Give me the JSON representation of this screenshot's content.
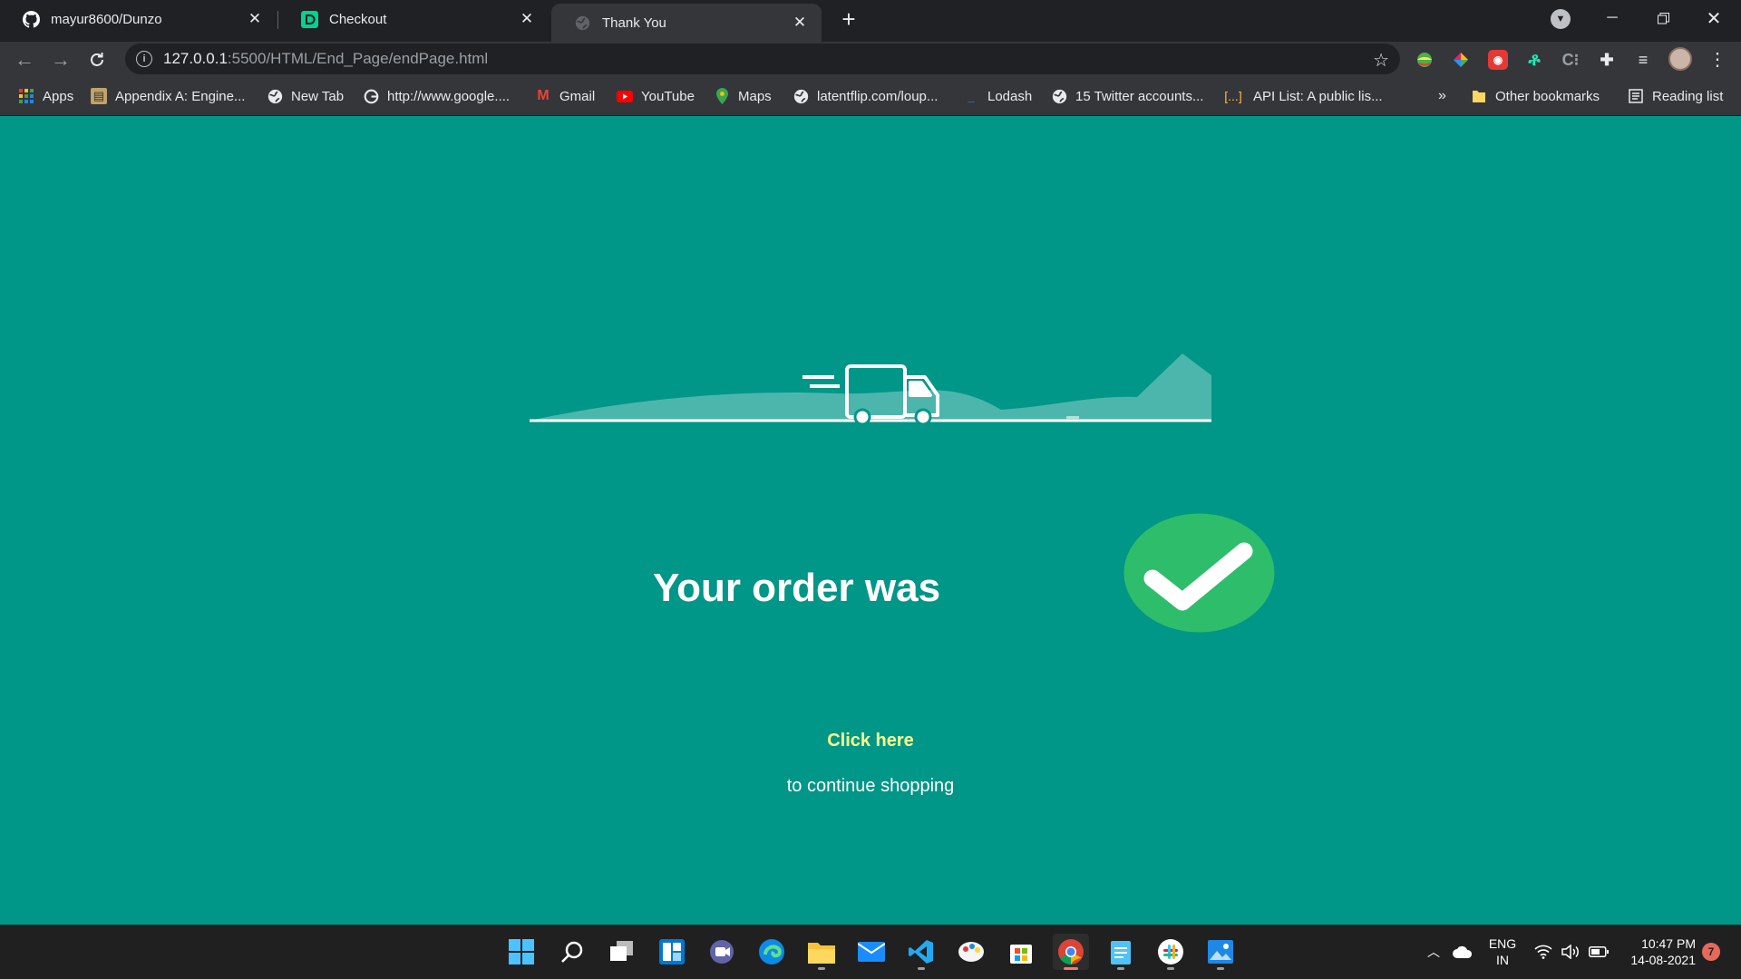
{
  "browser": {
    "tabs": [
      {
        "title": "mayur8600/Dunzo",
        "favicon": "github-icon",
        "active": false
      },
      {
        "title": "Checkout",
        "favicon": "dunzo-icon",
        "active": false
      },
      {
        "title": "Thank You",
        "favicon": "globe-icon",
        "active": true
      }
    ],
    "new_tab_label": "+",
    "address_bar": {
      "host": "127.0.0.1",
      "path": ":5500/HTML/End_Page/endPage.html"
    },
    "bookmarks": [
      {
        "label": "Apps",
        "icon": "apps-grid-icon"
      },
      {
        "label": "Appendix A: Engine...",
        "icon": "book-icon"
      },
      {
        "label": "New Tab",
        "icon": "globe-icon"
      },
      {
        "label": "http://www.google....",
        "icon": "google-icon"
      },
      {
        "label": "Gmail",
        "icon": "gmail-icon"
      },
      {
        "label": "YouTube",
        "icon": "youtube-icon"
      },
      {
        "label": "Maps",
        "icon": "maps-icon"
      },
      {
        "label": "latentflip.com/loup...",
        "icon": "globe-icon"
      },
      {
        "label": "Lodash",
        "icon": "underscore-icon"
      },
      {
        "label": "15 Twitter accounts...",
        "icon": "globe-icon"
      },
      {
        "label": "API List: A public lis...",
        "icon": "brackets-icon"
      }
    ],
    "bookmarks_overflow": "»",
    "other_bookmarks": "Other bookmarks",
    "reading_list": "Reading list"
  },
  "page": {
    "order_text": "Your order was",
    "click_here": "Click here",
    "continue_text": "to continue shopping",
    "colors": {
      "background": "#009688",
      "link": "#ffff8d",
      "check_circle": "#2ebd6b"
    }
  },
  "taskbar": {
    "apps": [
      "start-icon",
      "search-icon",
      "task-view-icon",
      "widgets-icon",
      "teams-chat-icon",
      "edge-icon",
      "file-explorer-icon",
      "mail-icon",
      "vscode-icon",
      "paint-icon",
      "store-icon",
      "chrome-icon",
      "notepad-icon",
      "slack-icon",
      "photos-icon"
    ],
    "language": {
      "line1": "ENG",
      "line2": "IN"
    },
    "time": "10:47 PM",
    "date": "14-08-2021",
    "notification_count": "7"
  }
}
